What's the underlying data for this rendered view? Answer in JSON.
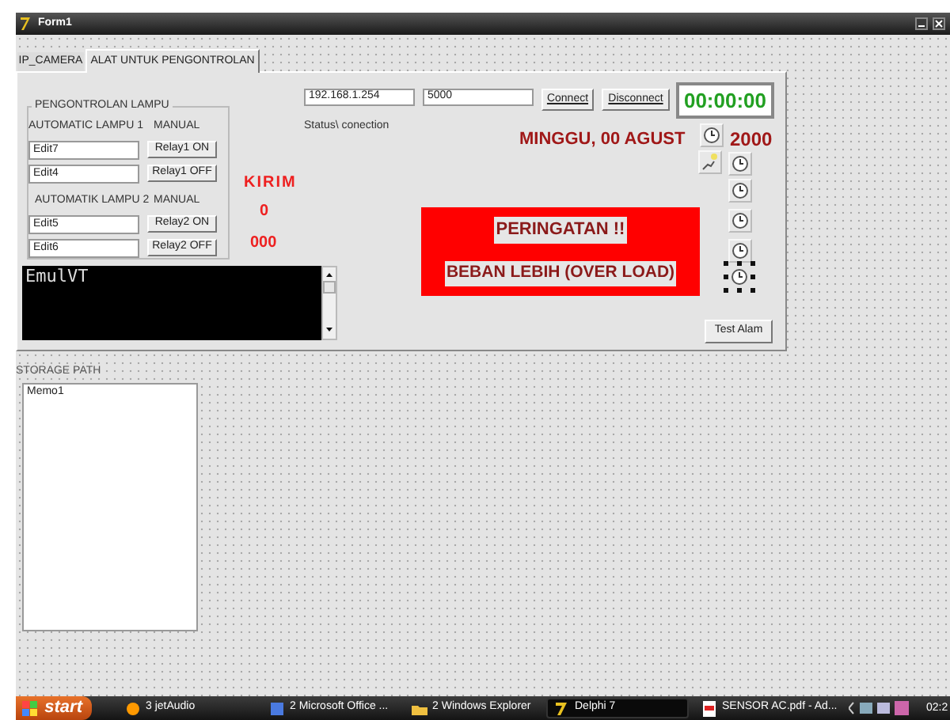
{
  "window": {
    "title": "Form1"
  },
  "tabs": [
    {
      "label": "IP_CAMERA",
      "selected": false
    },
    {
      "label": "ALAT UNTUK PENGONTROLAN",
      "selected": true
    }
  ],
  "lamp_group": {
    "caption": "PENGONTROLAN LAMPU",
    "sections": [
      {
        "auto_label": "AUTOMATIC LAMPU 1",
        "manual_label": "MANUAL",
        "rows": [
          {
            "value": "Edit7",
            "button": "Relay1 ON"
          },
          {
            "value": "Edit4",
            "button": "Relay1 OFF"
          }
        ]
      },
      {
        "auto_label": "AUTOMATIK LAMPU 2",
        "manual_label": "MANUAL",
        "rows": [
          {
            "value": "Edit5",
            "button": "Relay2 ON"
          },
          {
            "value": "Edit6",
            "button": "Relay2 OFF"
          }
        ]
      }
    ]
  },
  "send": {
    "label": "KIRIM",
    "count": "0",
    "code": "000"
  },
  "terminal": {
    "text": "EmulVT"
  },
  "connection": {
    "ip": "192.168.1.254",
    "port": "5000",
    "connect": "Connect",
    "disconnect": "Disconnect",
    "status": "Status\\ conection"
  },
  "clock": {
    "time": "00:00:00",
    "day_month": "MINGGU, 00 AGUST",
    "year": "2000"
  },
  "warning": {
    "title": "PERINGATAN !!",
    "message": "BEBAN LEBIH (OVER LOAD)"
  },
  "test_button": "Test Alam",
  "storage": {
    "label": "STORAGE PATH",
    "memo": "Memo1"
  },
  "taskbar": {
    "start": "start",
    "items": [
      {
        "label": "3 jetAudio",
        "selected": false
      },
      {
        "label": "2 Microsoft Office ...",
        "selected": false
      },
      {
        "label": "2 Windows Explorer",
        "selected": false
      },
      {
        "label": "Delphi 7",
        "selected": true
      },
      {
        "label": "SENSOR AC.pdf - Ad...",
        "selected": false
      }
    ],
    "clock": "02:2"
  }
}
